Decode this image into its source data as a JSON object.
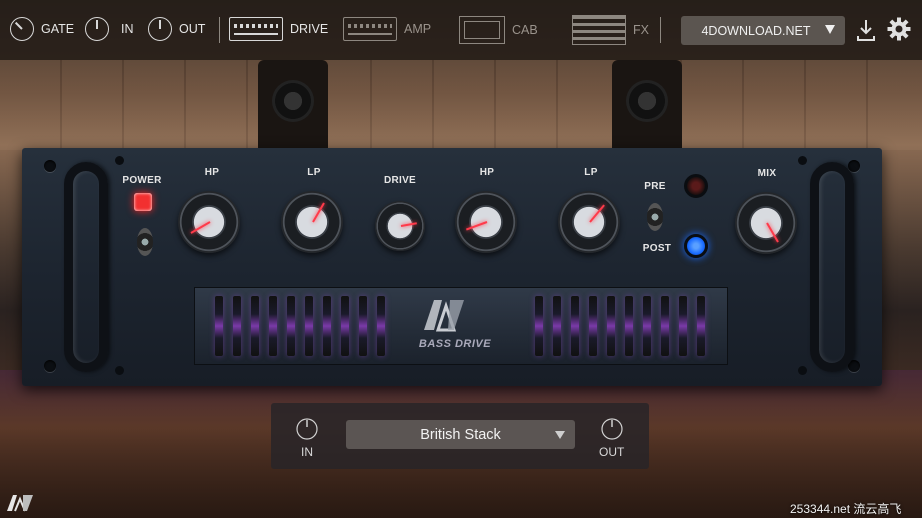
{
  "topbar": {
    "gate_label": "GATE",
    "in_label": "IN",
    "out_label": "OUT",
    "modules": [
      {
        "label": "DRIVE",
        "active": true
      },
      {
        "label": "AMP",
        "active": false
      },
      {
        "label": "CAB",
        "active": false
      },
      {
        "label": "FX",
        "active": false
      }
    ],
    "preset_menu_value": "4DOWNLOAD.NET",
    "download_icon": "download-icon",
    "settings_icon": "gear-icon"
  },
  "rack": {
    "power_label": "POWER",
    "knobs": [
      {
        "label": "HP"
      },
      {
        "label": "LP"
      },
      {
        "label": "DRIVE"
      },
      {
        "label": "HP"
      },
      {
        "label": "LP"
      },
      {
        "label": "MIX"
      }
    ],
    "pre_label": "PRE",
    "post_label": "POST",
    "product_name": "BASS DRIVE",
    "colors": {
      "power_led": "#f23030",
      "post_led": "#1a6cff",
      "pointer": "#ff3a4a",
      "vu_glow": "#7a3aa8"
    }
  },
  "bottom": {
    "in_label": "IN",
    "out_label": "OUT",
    "preset_value": "British Stack"
  },
  "watermark": "253344.net 流云高飞"
}
